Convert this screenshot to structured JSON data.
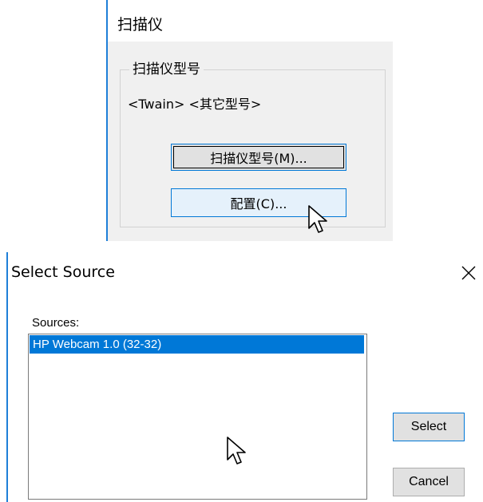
{
  "scanner_panel": {
    "heading": "扫描仪",
    "group_title": "扫描仪型号",
    "model_value": "<Twain> <其它型号>",
    "model_button_label": "扫描仪型号(M)...",
    "config_button_label": "配置(C)..."
  },
  "select_source_dialog": {
    "title": "Select Source",
    "close_icon": "close-icon",
    "sources_label": "Sources:",
    "sources": [
      "HP Webcam 1.0 (32-32)"
    ],
    "selected_source": "HP Webcam 1.0 (32-32)",
    "select_button_label": "Select",
    "cancel_button_label": "Cancel"
  },
  "colors": {
    "accent_blue": "#0078d7",
    "panel_bg": "#f0f0f0",
    "button_bg": "#e1e1e1",
    "hover_button_bg": "#e5f1fb"
  }
}
